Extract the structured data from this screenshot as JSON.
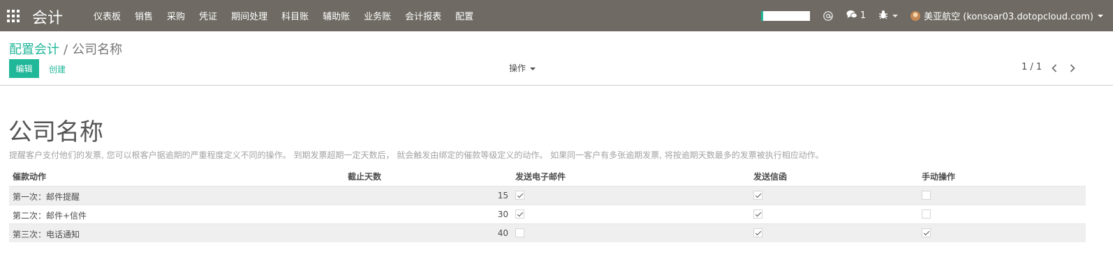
{
  "navbar": {
    "brand": "会计",
    "menu": [
      "仪表板",
      "销售",
      "采购",
      "凭证",
      "期间处理",
      "科目账",
      "辅助账",
      "业务账",
      "会计报表",
      "配置"
    ],
    "message_count": "1",
    "user": "美亚航空 (konsoar03.dotopcloud.com)"
  },
  "breadcrumb": {
    "parent": "配置会计",
    "separator": "/",
    "current": "公司名称"
  },
  "buttons": {
    "edit": "编辑",
    "create": "创建",
    "actions": "操作"
  },
  "pager": {
    "value": "1 / 1"
  },
  "record": {
    "title": "公司名称",
    "description": "提醒客户支付他们的发票, 您可以根客户据逾期的严重程度定义不同的操作。 到期发票超期一定天数后， 就会触发由绑定的催款等级定义的动作。 如果同一客户有多张逾期发票, 将按逾期天数最多的发票被执行相应动作。"
  },
  "table": {
    "headers": [
      "催款动作",
      "截止天数",
      "发送电子邮件",
      "发送信函",
      "手动操作"
    ],
    "rows": [
      {
        "name": "第一次：邮件提醒",
        "days": "15",
        "send_email": true,
        "send_letter": true,
        "manual": false
      },
      {
        "name": "第二次：邮件+信件",
        "days": "30",
        "send_email": true,
        "send_letter": true,
        "manual": false
      },
      {
        "name": "第三次：电话通知",
        "days": "40",
        "send_email": false,
        "send_letter": true,
        "manual": true
      }
    ]
  },
  "colors": {
    "navbar_bg": "#6f6a63",
    "accent": "#21b799",
    "row_stripe": "#efefef"
  },
  "icons": {
    "apps": "apps-grid-icon",
    "mention": "at-icon",
    "messages": "chat-bubbles-icon",
    "debug": "bug-icon",
    "user_avatar": "avatar-icon",
    "pager_prev": "chevron-left-icon",
    "pager_next": "chevron-right-icon"
  }
}
